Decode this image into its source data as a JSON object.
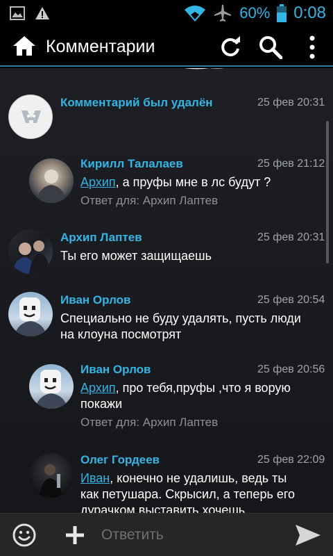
{
  "status_bar": {
    "battery_percent": "60%",
    "time": "0:08",
    "icons": [
      "image-icon",
      "warning-icon",
      "wifi-icon",
      "airplane-mode-icon",
      "battery-icon"
    ]
  },
  "action_bar": {
    "title": "Комментарии",
    "icons": [
      "home-icon",
      "refresh-icon",
      "search-icon",
      "overflow-menu-icon"
    ]
  },
  "comments": [
    {
      "name": "Комментарий был удалён",
      "date": "25 фев 20:31",
      "text": "",
      "reply": ""
    },
    {
      "name": "Кирилл Талалаев",
      "date": "25 фев 21:12",
      "mention": "Архип",
      "text": ", а пруфы мне в лс будут ?",
      "reply": "Ответ для: Архип Лаптев"
    },
    {
      "name": "Архип Лаптев",
      "date": "25 фев 20:31",
      "text": "Ты его может защищаешь",
      "reply": ""
    },
    {
      "name": "Иван Орлов",
      "date": "25 фев 20:54",
      "text_lines": [
        "Специально не буду удалять, пусть люди",
        "на клоуна посмотрят"
      ],
      "reply": ""
    },
    {
      "name": "Иван Орлов",
      "date": "25 фев 20:56",
      "mention": "Архип",
      "text_line1": ", про тебя,пруфы ,что я ворую",
      "text_line2": "покажи",
      "reply": "Ответ для: Архип Лаптев"
    },
    {
      "name": "Олег Гордеев",
      "date": "25 фев 22:09",
      "mention": "Иван",
      "text_line1": ", конечно не удалишь, ведь ты",
      "text_line2": "как петушара. Скрысил, а теперь его",
      "text_line3": "дурачком выставить хочешь",
      "reply": ""
    }
  ],
  "bottom_bar": {
    "placeholder": "Ответить",
    "icons": [
      "emoji-icon",
      "plus-icon",
      "send-icon"
    ]
  },
  "colors": {
    "accent": "#33b5e5",
    "background": "#1b1d21",
    "text": "#ffffff",
    "secondary": "#a0a4a9"
  }
}
